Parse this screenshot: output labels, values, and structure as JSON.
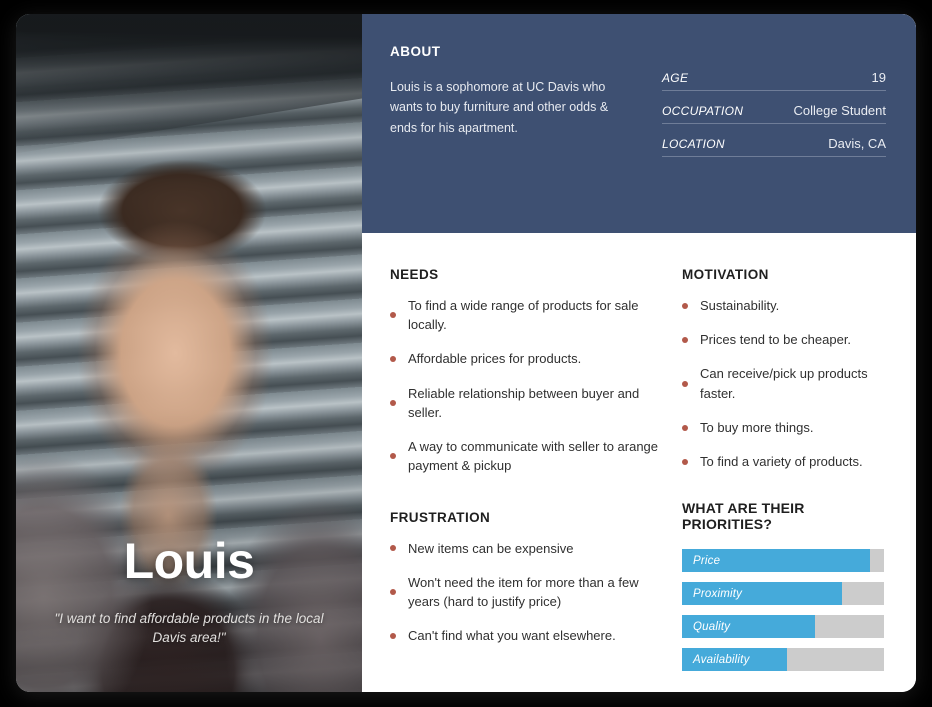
{
  "persona": {
    "name": "Louis",
    "quote": "\"I want to find affordable products in the local Davis area!\""
  },
  "about": {
    "title": "ABOUT",
    "description": "Louis is a sophomore at UC Davis who wants to buy furniture and other odds & ends for his apartment.",
    "stats": [
      {
        "label": "AGE",
        "value": "19"
      },
      {
        "label": "OCCUPATION",
        "value": "College Student"
      },
      {
        "label": "LOCATION",
        "value": "Davis, CA"
      }
    ]
  },
  "needs": {
    "title": "NEEDS",
    "items": [
      "To find a wide range of products for sale locally.",
      "Affordable prices for products.",
      "Reliable relationship between buyer and seller.",
      "A way to communicate with seller to arange payment & pickup"
    ]
  },
  "motivation": {
    "title": "MOTIVATION",
    "items": [
      "Sustainability.",
      "Prices tend to be cheaper.",
      "Can receive/pick up products faster.",
      "To buy more things.",
      "To find a variety of products."
    ]
  },
  "frustration": {
    "title": "FRUSTRATION",
    "items": [
      "New items can be expensive",
      "Won't need the item for more than a few years (hard to justify price)",
      "Can't find what you want elsewhere."
    ]
  },
  "chart_data": {
    "type": "bar",
    "title": "WHAT ARE THEIR PRIORITIES?",
    "orientation": "horizontal",
    "categories": [
      "Price",
      "Proximity",
      "Quality",
      "Availability"
    ],
    "values": [
      93,
      79,
      66,
      52
    ],
    "xlabel": "",
    "ylabel": "",
    "xlim": [
      0,
      100
    ],
    "grid": false,
    "legend": false,
    "fill_color": "#45aada",
    "track_color": "#cccccc"
  },
  "colors": {
    "navy_band": "#3e5072",
    "bullet": "#b2594a",
    "bar_fill": "#45aada",
    "bar_track": "#cccccc",
    "card_background": "#ffffff",
    "page_background": "#000000"
  }
}
